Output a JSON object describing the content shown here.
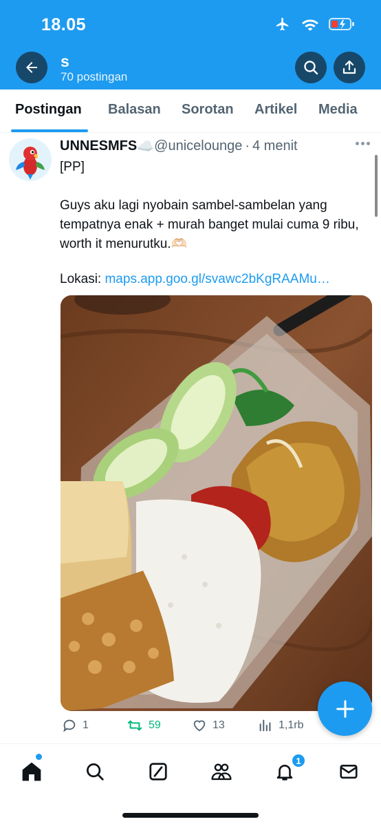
{
  "status_bar": {
    "time": "18.05",
    "icons": [
      "airplane-icon",
      "wifi-icon",
      "battery-icon"
    ]
  },
  "header": {
    "title": "s",
    "subtitle": "70 postingan",
    "back_icon": "arrow-left-icon",
    "actions": [
      "search-icon",
      "share-icon"
    ]
  },
  "tabs": [
    {
      "label": "Postingan",
      "active": true
    },
    {
      "label": "Balasan",
      "active": false
    },
    {
      "label": "Sorotan",
      "active": false
    },
    {
      "label": "Artikel",
      "active": false
    },
    {
      "label": "Media",
      "active": false
    }
  ],
  "post": {
    "author": "UNNESMFS",
    "author_emoji": "☁️",
    "handle": "@unicelounge",
    "separator": "·",
    "time": "4 menit",
    "lines": [
      "[PP]",
      "Guys aku lagi nyobain sambel-sambelan yang tempatnya enak + murah banget mulai cuma 9 ribu, worth it menurutku.🫶🏻"
    ],
    "location_label": "Lokasi: ",
    "location_link": "maps.app.goo.gl/svawc2bKgRAAMu…",
    "image_description_icon": "food-photo",
    "stats": {
      "replies": "1",
      "retweets": "59",
      "likes": "13",
      "views": "1,1rb"
    }
  },
  "fab": {
    "icon": "plus-icon"
  },
  "bottom_nav": {
    "items": [
      "home-icon",
      "search-icon",
      "compose-grok-icon",
      "communities-icon",
      "bell-icon",
      "mail-icon"
    ],
    "notification_count": "1"
  },
  "colors": {
    "accent": "#1d9bf0",
    "header_button": "#17486a",
    "retweet": "#00ba7c",
    "muted": "#536471"
  }
}
